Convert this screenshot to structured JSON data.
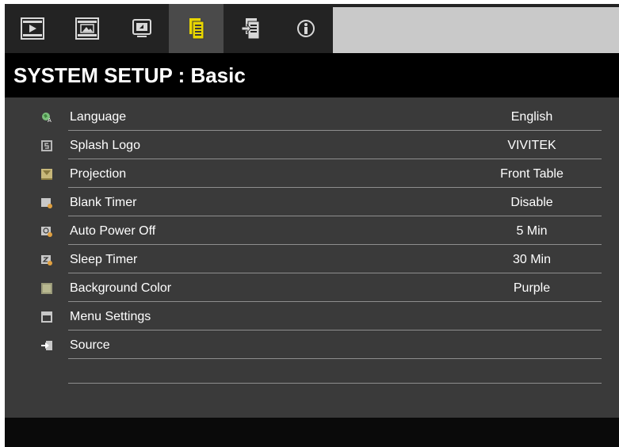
{
  "tabs": [
    {
      "icon": "play-picture-icon"
    },
    {
      "icon": "image-settings-icon"
    },
    {
      "icon": "display-icon"
    },
    {
      "icon": "system-setup-basic-icon",
      "active": true
    },
    {
      "icon": "system-setup-advanced-icon"
    },
    {
      "icon": "information-icon"
    }
  ],
  "title": "SYSTEM SETUP : Basic",
  "menu": {
    "items": [
      {
        "icon": "language-icon",
        "label": "Language",
        "value": "English"
      },
      {
        "icon": "splash-logo-icon",
        "label": "Splash Logo",
        "value": "VIVITEK"
      },
      {
        "icon": "projection-icon",
        "label": "Projection",
        "value": "Front Table"
      },
      {
        "icon": "blank-timer-icon",
        "label": "Blank Timer",
        "value": "Disable"
      },
      {
        "icon": "auto-power-off-icon",
        "label": "Auto Power Off",
        "value": "5 Min"
      },
      {
        "icon": "sleep-timer-icon",
        "label": "Sleep Timer",
        "value": "30 Min"
      },
      {
        "icon": "background-color-icon",
        "label": "Background Color",
        "value": "Purple"
      },
      {
        "icon": "menu-settings-icon",
        "label": "Menu Settings",
        "value": ""
      },
      {
        "icon": "source-icon",
        "label": "Source",
        "value": ""
      }
    ]
  },
  "colors": {
    "panel": "#3a3a3a",
    "title_bar": "#000000",
    "active_tab": "#4a4a4a",
    "accent_yellow": "#e8d600",
    "text": "#ffffff"
  }
}
